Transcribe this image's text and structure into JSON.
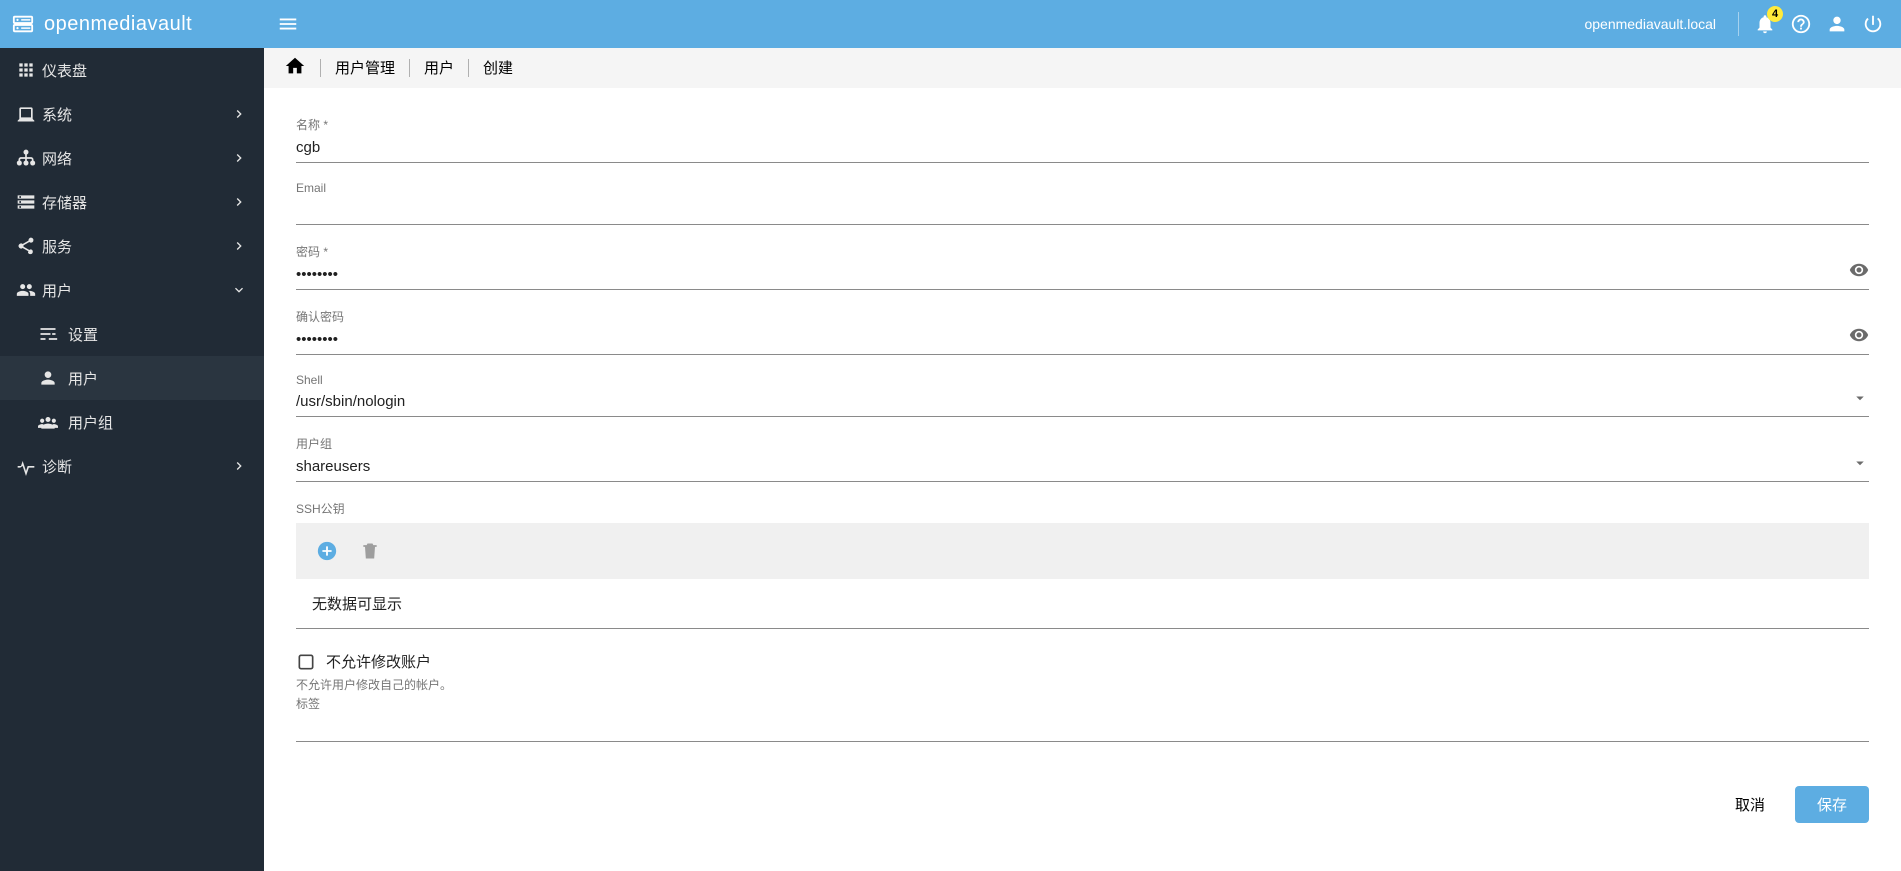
{
  "brand": "openmediavault",
  "header": {
    "hostname": "openmediavault.local",
    "notifications_count": "4"
  },
  "sidebar": {
    "dashboard": "仪表盘",
    "system": "系统",
    "network": "网络",
    "storage": "存储器",
    "services": "服务",
    "users": "用户",
    "users_settings": "设置",
    "users_users": "用户",
    "users_groups": "用户组",
    "diagnostics": "诊断"
  },
  "breadcrumb": {
    "a": "用户管理",
    "b": "用户",
    "c": "创建"
  },
  "form": {
    "name_label": "名称 *",
    "name_value": "cgb",
    "email_label": "Email",
    "email_value": "",
    "password_label": "密码 *",
    "password_value": "••••••••",
    "confirm_label": "确认密码",
    "confirm_value": "••••••••",
    "shell_label": "Shell",
    "shell_value": "/usr/sbin/nologin",
    "group_label": "用户组",
    "group_value": "shareusers",
    "ssh_label": "SSH公钥",
    "ssh_empty": "无数据可显示",
    "disallow_label": "不允许修改账户",
    "disallow_help": "不允许用户修改自己的帐户。",
    "tags_label": "标签",
    "tags_value": "",
    "cancel": "取消",
    "save": "保存"
  }
}
